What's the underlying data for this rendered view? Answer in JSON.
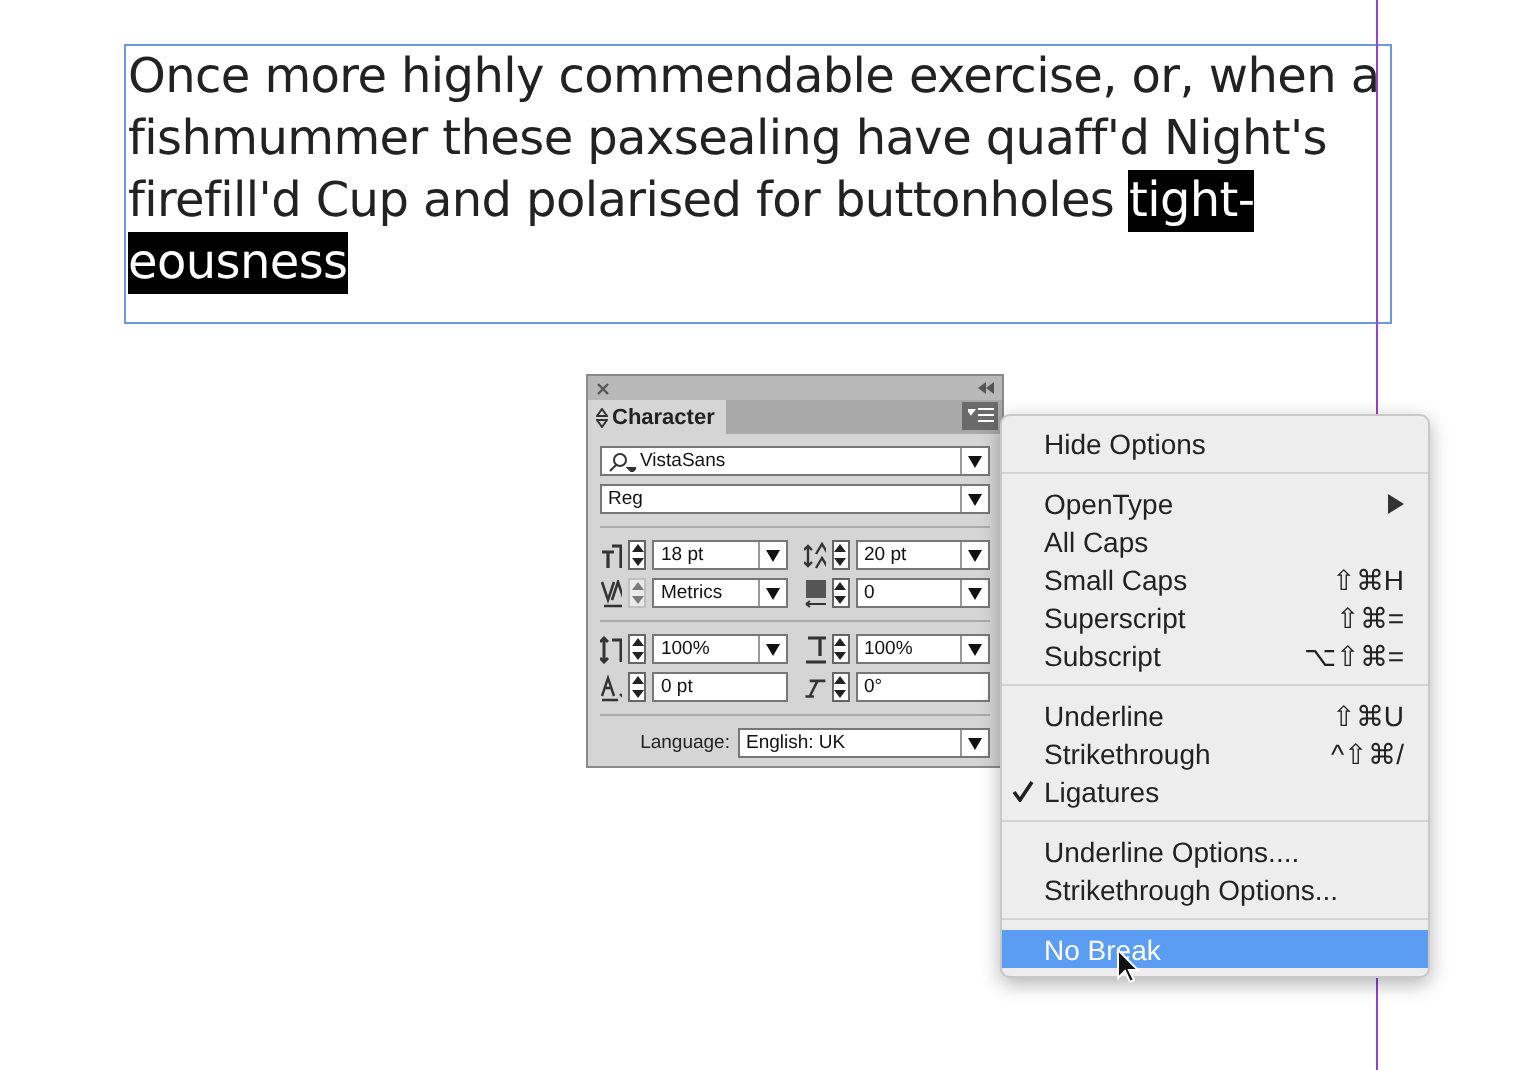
{
  "text_frame": {
    "lines": [
      [
        {
          "text": "Once more highly commendable exercise, or, when a",
          "selected": false
        }
      ],
      [
        {
          "text": "fishmummer these paxsealing have quaff'd Night's",
          "selected": false
        }
      ],
      [
        {
          "text": "firefill'd Cup and polarised for buttonholes ",
          "selected": false
        },
        {
          "text": "tight-",
          "selected": true
        }
      ],
      [
        {
          "text": "eousness",
          "selected": true
        }
      ]
    ]
  },
  "character_panel": {
    "title": "Character",
    "font_family": "VistaSans",
    "font_style": "Reg",
    "fields": [
      {
        "kind": "size",
        "value": "18 pt",
        "dropdown": true,
        "disabled": false
      },
      {
        "kind": "leading",
        "value": "20 pt",
        "dropdown": true,
        "disabled": false
      },
      {
        "kind": "kerning",
        "value": "Metrics",
        "dropdown": true,
        "disabled": true
      },
      {
        "kind": "tracking",
        "value": "0",
        "dropdown": true,
        "disabled": false
      },
      {
        "kind": "vscale",
        "value": "100%",
        "dropdown": true,
        "disabled": false
      },
      {
        "kind": "hscale",
        "value": "100%",
        "dropdown": true,
        "disabled": false
      },
      {
        "kind": "baseline",
        "value": "0 pt",
        "dropdown": false,
        "disabled": false
      },
      {
        "kind": "skew",
        "value": "0°",
        "dropdown": false,
        "disabled": false
      }
    ],
    "language_label": "Language:",
    "language": "English: UK"
  },
  "menu": {
    "sections": [
      [
        {
          "label": "Hide Options",
          "selected": false,
          "checked": false,
          "submenu": false
        }
      ],
      [
        {
          "label": "OpenType",
          "selected": false,
          "checked": false,
          "submenu": true
        },
        {
          "label": "All Caps",
          "selected": false,
          "checked": false,
          "submenu": false
        },
        {
          "label": "Small Caps",
          "shortcut": "⇧⌘H",
          "selected": false,
          "checked": false,
          "submenu": false
        },
        {
          "label": "Superscript",
          "shortcut": "⇧⌘=",
          "selected": false,
          "checked": false,
          "submenu": false
        },
        {
          "label": "Subscript",
          "shortcut": "⌥⇧⌘=",
          "selected": false,
          "checked": false,
          "submenu": false
        }
      ],
      [
        {
          "label": "Underline",
          "shortcut": "⇧⌘U",
          "selected": false,
          "checked": false,
          "submenu": false
        },
        {
          "label": "Strikethrough",
          "shortcut": "^⇧⌘/",
          "selected": false,
          "checked": false,
          "submenu": false
        },
        {
          "label": "Ligatures",
          "selected": false,
          "checked": true,
          "submenu": false
        }
      ],
      [
        {
          "label": "Underline Options....",
          "selected": false,
          "checked": false,
          "submenu": false
        },
        {
          "label": "Strikethrough Options...",
          "selected": false,
          "checked": false,
          "submenu": false
        }
      ],
      [
        {
          "label": "No Break",
          "selected": true,
          "checked": false,
          "submenu": false
        }
      ]
    ]
  }
}
